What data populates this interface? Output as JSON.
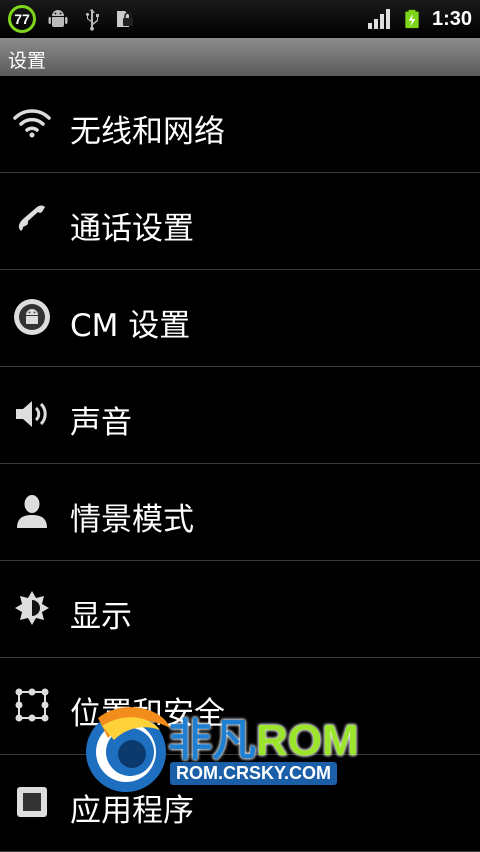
{
  "status_bar": {
    "badge_value": "77",
    "time": "1:30",
    "icons": [
      "notification-77-icon",
      "android-debug-icon",
      "usb-icon",
      "lock-icon",
      "signal-icon",
      "battery-charging-icon"
    ]
  },
  "title_bar": {
    "title": "设置"
  },
  "settings": {
    "items": [
      {
        "label": "无线和网络",
        "icon": "wifi-icon"
      },
      {
        "label": "通话设置",
        "icon": "phone-icon"
      },
      {
        "label": "CM 设置",
        "icon": "cyanogenmod-icon"
      },
      {
        "label": "声音",
        "icon": "speaker-icon"
      },
      {
        "label": "情景模式",
        "icon": "person-icon"
      },
      {
        "label": "显示",
        "icon": "brightness-icon"
      },
      {
        "label": "位置和安全",
        "icon": "lock-pattern-icon"
      },
      {
        "label": "应用程序",
        "icon": "applications-icon"
      }
    ]
  },
  "watermark": {
    "brand": "非凡",
    "rom": "ROM",
    "url": "ROM.CRSKY.COM"
  },
  "colors": {
    "accent_green": "#7fd51a",
    "title_bar": "#7a7a7a",
    "divider": "#3a3a3a"
  }
}
